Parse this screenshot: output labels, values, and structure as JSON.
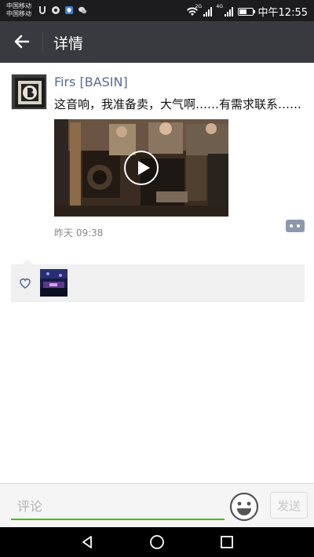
{
  "status_bar": {
    "carrier_1": "中国移动",
    "carrier_2": "中国移动",
    "network_1": "2G",
    "network_2": "4G",
    "battery_level": 0.55,
    "time": "中午12:55"
  },
  "header": {
    "back_icon": "arrow-left-icon",
    "title": "详情"
  },
  "post": {
    "username": "Firs [BASIN]",
    "text": "这音响，我准备卖，大气啊……有需求联系……",
    "video_icon": "play-icon",
    "timestamp": "昨天 09:38",
    "more_icon": "more-dots-icon"
  },
  "likes": {
    "icon": "heart-icon"
  },
  "comment_bar": {
    "placeholder": "评论",
    "emoji_icon": "smiley-icon",
    "send_label": "发送"
  },
  "colors": {
    "header_bg": "#393a3f",
    "username": "#576b95",
    "input_underline": "#45c01a"
  },
  "navbar": {
    "icons": [
      "back-triangle-icon",
      "home-circle-icon",
      "recents-square-icon"
    ]
  }
}
